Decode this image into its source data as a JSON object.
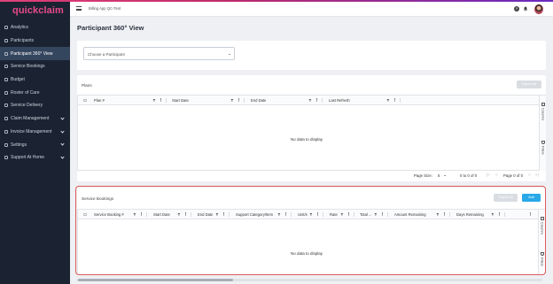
{
  "app": {
    "logo": "quickclaim",
    "breadcrumb": "Billing App QC-Test"
  },
  "sidebar": {
    "items": [
      {
        "label": "Analytics",
        "icon": "analytics-icon"
      },
      {
        "label": "Participants",
        "icon": "participants-icon"
      },
      {
        "label": "Participant 360° View",
        "icon": "view-360-icon",
        "active": true
      },
      {
        "label": "Service Bookings",
        "icon": "service-bookings-icon"
      },
      {
        "label": "Budget",
        "icon": "budget-icon"
      },
      {
        "label": "Roster of Care",
        "icon": "roster-icon"
      },
      {
        "label": "Service Delivery",
        "icon": "service-delivery-icon"
      },
      {
        "label": "Claim Management",
        "icon": "claim-icon",
        "expandable": true
      },
      {
        "label": "Invoice Management",
        "icon": "invoice-icon",
        "expandable": true
      },
      {
        "label": "Settings",
        "icon": "gear-icon",
        "expandable": true
      },
      {
        "label": "Support At Home",
        "icon": "home-icon",
        "expandable": true
      }
    ]
  },
  "page": {
    "title": "Participant 360° View"
  },
  "selector": {
    "placeholder": "Choose a Participant"
  },
  "plans": {
    "title": "Plans",
    "export_label": "Export All",
    "columns": [
      "Plan #",
      "Start Date",
      "End Date",
      "Last Refresh"
    ],
    "empty": "No data to display",
    "side_tabs": [
      "Columns",
      "Filters"
    ],
    "pagination": {
      "page_size_label": "Page Size:",
      "page_size": "5",
      "range": "0 to 0 of 0",
      "page": "Page 0 of 0"
    }
  },
  "bookings": {
    "title": "Service Bookings",
    "export_label": "Export All",
    "add_label": "Add",
    "columns": [
      "Service Booking #",
      "Start Date",
      "End Date",
      "Support Category/Item",
      "Unit/s",
      "Rate",
      "Total ...",
      "Amount Remaining",
      "Days Remaining"
    ],
    "empty": "No data to display",
    "side_tabs": [
      "Columns",
      "Filters"
    ]
  },
  "colors": {
    "accent": "#29a8e8",
    "brand": "#e84a8a",
    "sidebar_bg": "#1b2332",
    "highlight": "#e05a5a"
  }
}
